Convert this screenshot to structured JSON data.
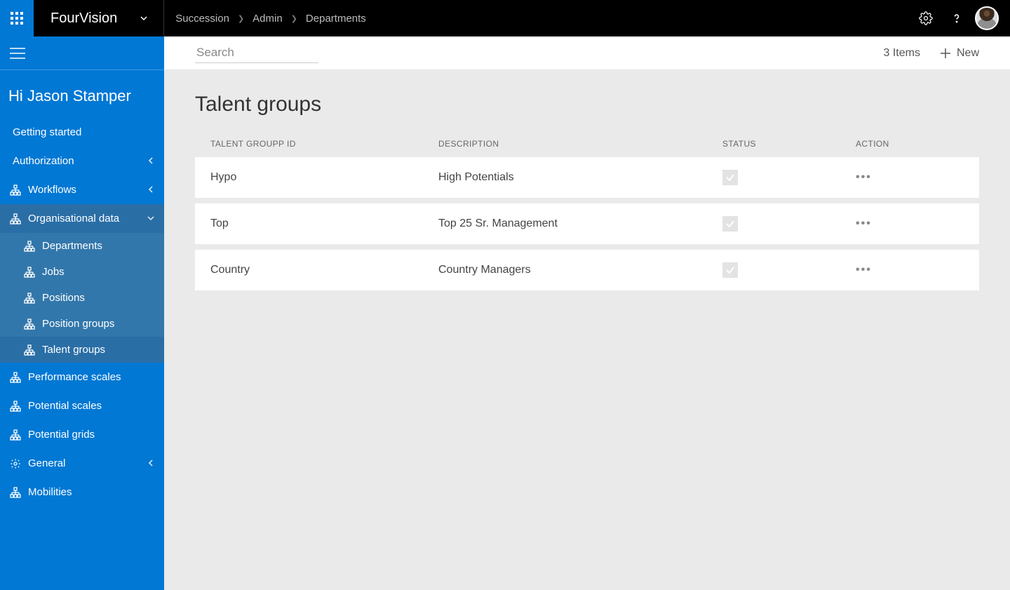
{
  "topbar": {
    "brand": "FourVision",
    "breadcrumbs": [
      "Succession",
      "Admin",
      "Departments"
    ]
  },
  "sidebar": {
    "greeting": "Hi Jason Stamper",
    "items": [
      {
        "label": "Getting started",
        "has_icon": false,
        "expand": null
      },
      {
        "label": "Authorization",
        "has_icon": false,
        "expand": "left"
      },
      {
        "label": "Workflows",
        "has_icon": true,
        "expand": "left"
      },
      {
        "label": "Organisational data",
        "has_icon": true,
        "expand": "down",
        "active": true,
        "children": [
          {
            "label": "Departments"
          },
          {
            "label": "Jobs"
          },
          {
            "label": "Positions"
          },
          {
            "label": "Position groups"
          },
          {
            "label": "Talent groups",
            "active": true
          }
        ]
      },
      {
        "label": "Performance scales",
        "has_icon": true,
        "expand": null
      },
      {
        "label": "Potential scales",
        "has_icon": true,
        "expand": null
      },
      {
        "label": "Potential grids",
        "has_icon": true,
        "expand": null
      },
      {
        "label": "General",
        "has_icon": true,
        "icon": "gear",
        "expand": "left"
      },
      {
        "label": "Mobilities",
        "has_icon": true,
        "expand": null
      }
    ]
  },
  "toolbar": {
    "search_placeholder": "Search",
    "item_count": "3 Items",
    "new_label": "New"
  },
  "page": {
    "title": "Talent groups",
    "columns": [
      "TALENT GROUPP ID",
      "DESCRIPTION",
      "STATUS",
      "ACTION"
    ],
    "rows": [
      {
        "id": "Hypo",
        "desc": "High Potentials"
      },
      {
        "id": "Top",
        "desc": "Top 25 Sr. Management"
      },
      {
        "id": "Country",
        "desc": "Country Managers"
      }
    ]
  }
}
